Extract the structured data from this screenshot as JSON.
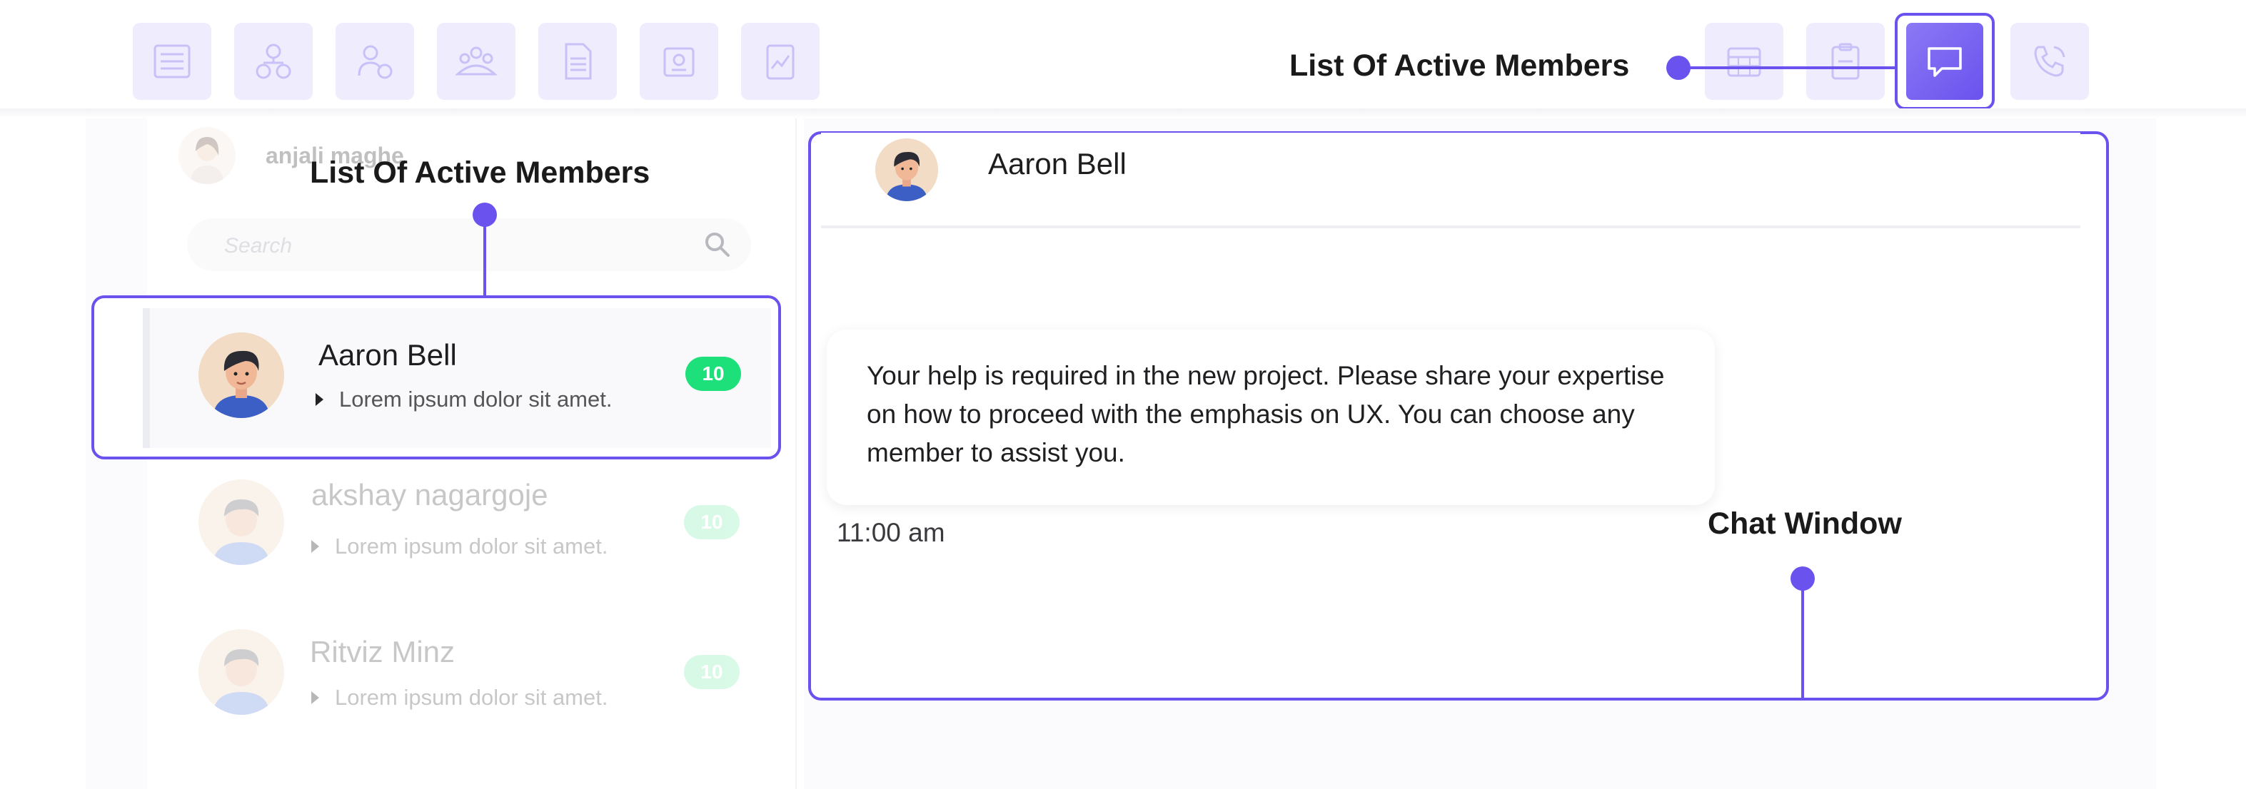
{
  "toolbar": {
    "left_icons": [
      "list-icon",
      "org-chart-icon",
      "people-money-icon",
      "team-icon",
      "document-icon",
      "id-card-icon",
      "report-icon"
    ],
    "right_icons": [
      "calendar-icon",
      "clipboard-icon",
      "chat-icon",
      "phone-icon"
    ],
    "active_icon": "chat-icon"
  },
  "current_user": {
    "name": "anjali maghe"
  },
  "search": {
    "placeholder": "Search"
  },
  "contacts": [
    {
      "name": "Aaron Bell",
      "snippet": "Lorem ipsum dolor sit amet.",
      "unread": "10",
      "selected": true
    },
    {
      "name": "akshay nagargoje",
      "snippet": "Lorem ipsum dolor sit amet.",
      "unread": "10",
      "selected": false
    },
    {
      "name": "Ritviz Minz",
      "snippet": "Lorem ipsum dolor sit amet.",
      "unread": "10",
      "selected": false
    }
  ],
  "chat": {
    "contact_name": "Aaron Bell",
    "message": "Your help is required in the new project. Please share your expertise on how to proceed with the emphasis on UX. You can choose any member to assist you.",
    "time": "11:00 am"
  },
  "annotations": {
    "toolbar_label": "List Of Active Members",
    "list_label": "List Of Active Members",
    "chat_label": "Chat Window"
  },
  "colors": {
    "accent": "#6a52ee",
    "badge": "#1ee07a",
    "icon_tile": "#efedfd"
  }
}
